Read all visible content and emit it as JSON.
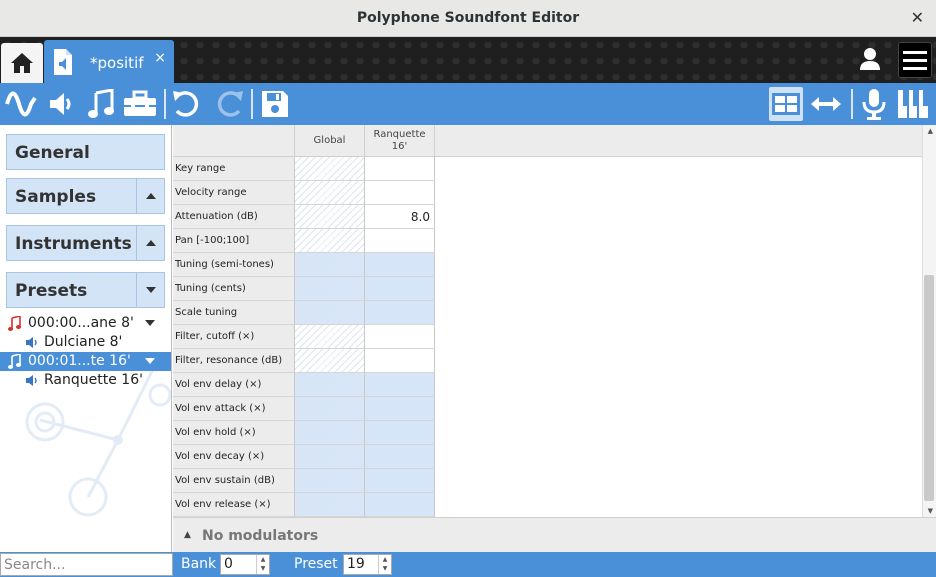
{
  "window": {
    "title": "Polyphone Soundfont Editor",
    "close_glyph": "✕"
  },
  "tabs": {
    "home_icon": "home-icon",
    "file_tab_label": "*positif",
    "file_tab_close": "×"
  },
  "toolbar": {
    "left_icons": [
      "waveform-icon",
      "speaker-icon",
      "music-note-icon",
      "toolbox-icon",
      "undo-icon",
      "redo-icon",
      "save-icon"
    ],
    "right_icons": [
      "table-view-icon",
      "stretch-icon",
      "microphone-icon",
      "piano-icon"
    ],
    "accent_color": "#4a90d9"
  },
  "sidebar": {
    "sections": [
      {
        "label": "General"
      },
      {
        "label": "Samples",
        "arrow": "▲"
      },
      {
        "label": "Instruments",
        "arrow": "▲"
      },
      {
        "label": "Presets",
        "arrow": "▼"
      }
    ],
    "tree": [
      {
        "label": "000:00...ane 8'",
        "type": "preset",
        "expanded": true,
        "selected": false
      },
      {
        "label": "Dulciane 8'",
        "type": "instrument"
      },
      {
        "label": "000:01...te 16'",
        "type": "preset",
        "expanded": true,
        "selected": true
      },
      {
        "label": "Ranquette 16'",
        "type": "instrument"
      }
    ]
  },
  "table": {
    "columns": [
      "Global",
      "Ranquette\n16'"
    ],
    "rows": [
      {
        "name": "Key range",
        "global": "",
        "instrument": "",
        "highlight": false
      },
      {
        "name": "Velocity range",
        "global": "",
        "instrument": "",
        "highlight": false
      },
      {
        "name": "Attenuation (dB)",
        "global": "",
        "instrument": "8.0",
        "highlight": false
      },
      {
        "name": "Pan [-100;100]",
        "global": "",
        "instrument": "",
        "highlight": false
      },
      {
        "name": "Tuning (semi-tones)",
        "global": "",
        "instrument": "",
        "highlight": true
      },
      {
        "name": "Tuning (cents)",
        "global": "",
        "instrument": "",
        "highlight": true
      },
      {
        "name": "Scale tuning",
        "global": "",
        "instrument": "",
        "highlight": true
      },
      {
        "name": "Filter, cutoff (×)",
        "global": "",
        "instrument": "",
        "highlight": false
      },
      {
        "name": "Filter, resonance (dB)",
        "global": "",
        "instrument": "",
        "highlight": false
      },
      {
        "name": "Vol env delay (×)",
        "global": "",
        "instrument": "",
        "highlight": true
      },
      {
        "name": "Vol env attack (×)",
        "global": "",
        "instrument": "",
        "highlight": true
      },
      {
        "name": "Vol env hold (×)",
        "global": "",
        "instrument": "",
        "highlight": true
      },
      {
        "name": "Vol env decay (×)",
        "global": "",
        "instrument": "",
        "highlight": true
      },
      {
        "name": "Vol env sustain (dB)",
        "global": "",
        "instrument": "",
        "highlight": true
      },
      {
        "name": "Vol env release (×)",
        "global": "",
        "instrument": "",
        "highlight": true
      }
    ]
  },
  "modulators": {
    "arrow": "▲",
    "label": "No modulators"
  },
  "bottom": {
    "search_placeholder": "Search...",
    "bank_label": "Bank",
    "bank_value": "0",
    "preset_label": "Preset",
    "preset_value": "19"
  }
}
